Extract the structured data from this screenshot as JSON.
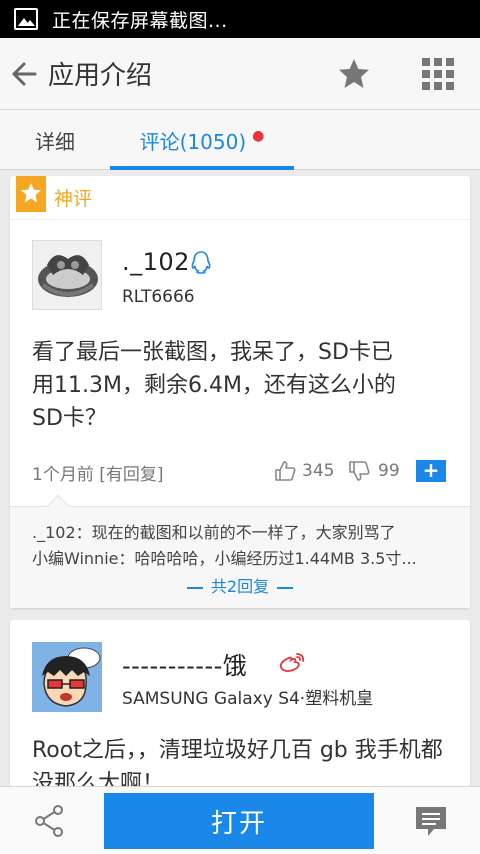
{
  "status_bar": {
    "notification": "正在保存屏幕截图..."
  },
  "header": {
    "title": "应用介绍"
  },
  "tabs": [
    {
      "label": "详细"
    },
    {
      "label": "评论(1050)"
    }
  ],
  "featured": {
    "label": "神评"
  },
  "comments": [
    {
      "username": "._102",
      "device": "RLT6666",
      "text": "看了最后一张截图，我呆了，SD卡已用11.3M，剩余6.4M，还有这么小的SD卡？",
      "time": "1个月前 [有回复]",
      "likes": "345",
      "dislikes": "99",
      "replies": [
        "._102：现在的截图和以前的不一样了，大家别骂了",
        "小编Winnie：哈哈哈哈，小编经历过1.44MB 3.5寸..."
      ],
      "more_replies": "共2回复"
    },
    {
      "username": "-----------饿",
      "device": "SAMSUNG Galaxy S4·塑料机皇",
      "text": "Root之后，，清理垃圾好几百 gb  我手机都没那么大啊！"
    }
  ],
  "bottom_bar": {
    "open_label": "打开"
  },
  "colors": {
    "accent": "#1a88e8",
    "featured": "#f5a623",
    "dot": "#e8343a"
  }
}
